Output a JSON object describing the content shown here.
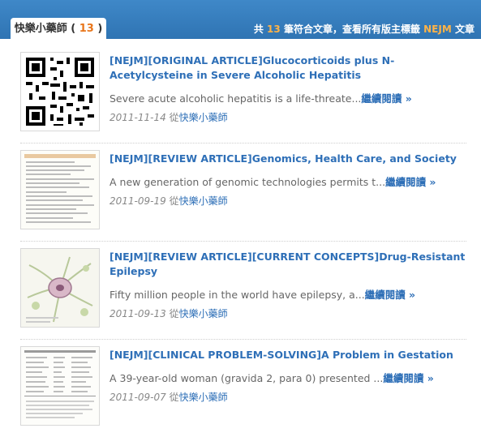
{
  "header": {
    "tab_label": "快樂小藥師",
    "tab_count": "13",
    "summary_prefix": "共",
    "summary_count": "13",
    "summary_middle": "筆符合文章，查看所有版主標籤",
    "summary_tag": "NEJM",
    "summary_suffix": "文章"
  },
  "articles": [
    {
      "title": "[NEJM][ORIGINAL ARTICLE]Glucocorticoids plus N-Acetylcysteine in Severe Alcoholic Hepatitis",
      "excerpt": "Severe acute alcoholic hepatitis is a life-threate...",
      "more": "繼續閱讀 »",
      "date": "2011-11-14",
      "from": "從",
      "author": "快樂小藥師",
      "thumb_icon": "qr-code-icon"
    },
    {
      "title": "[NEJM][REVIEW ARTICLE]Genomics, Health Care, and Society",
      "excerpt": "A new generation of genomic technologies permits t...",
      "more": "繼續閱讀 »",
      "date": "2011-09-19",
      "from": "從",
      "author": "快樂小藥師",
      "thumb_icon": "document-table-icon"
    },
    {
      "title": "[NEJM][REVIEW ARTICLE][CURRENT CONCEPTS]Drug-Resistant Epilepsy",
      "excerpt": "Fifty million people in the world have epilepsy, a...",
      "more": "繼續閱讀 »",
      "date": "2011-09-13",
      "from": "從",
      "author": "快樂小藥師",
      "thumb_icon": "neuron-illustration-icon"
    },
    {
      "title": "[NEJM][CLINICAL PROBLEM-SOLVING]A Problem in Gestation",
      "excerpt": "A 39-year-old woman (gravida 2, para 0) presented ...",
      "more": "繼續閱讀 »",
      "date": "2011-09-07",
      "from": "從",
      "author": "快樂小藥師",
      "thumb_icon": "lab-values-table-icon"
    }
  ]
}
